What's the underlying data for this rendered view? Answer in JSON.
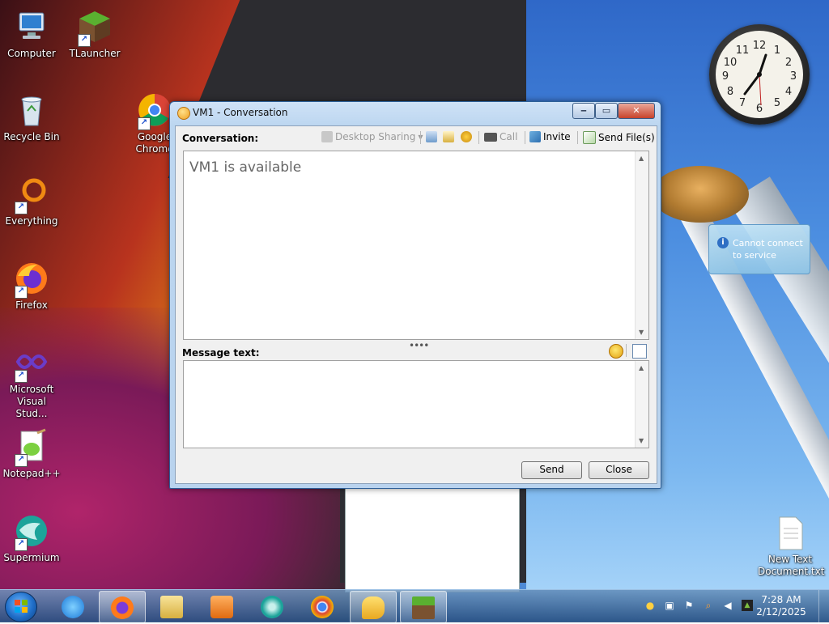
{
  "desktop": {
    "icons": [
      {
        "label": "Computer"
      },
      {
        "label": "TLauncher"
      },
      {
        "label": "Recycle Bin"
      },
      {
        "label": "Google Chrome"
      },
      {
        "label": "Everything"
      },
      {
        "label": "Firefox"
      },
      {
        "label": "Microsoft Visual Stud..."
      },
      {
        "label": "Notepad++"
      },
      {
        "label": "Supermium"
      },
      {
        "label": "New Text Document.txt"
      }
    ]
  },
  "clock_gadget": {
    "numbers": [
      "12",
      "1",
      "2",
      "3",
      "4",
      "5",
      "6",
      "7",
      "8",
      "9",
      "10",
      "11"
    ]
  },
  "balloon": {
    "text": "Cannot connect to service",
    "icon": "info-icon"
  },
  "window": {
    "title": "VM1 - Conversation",
    "toolbar": {
      "conversation_label": "Conversation:",
      "desktop_sharing": "Desktop Sharing",
      "call": "Call",
      "invite": "Invite",
      "send_files": "Send File(s)"
    },
    "conversation_text": "VM1 is available",
    "message_label": "Message text:",
    "message_value": "",
    "send_button": "Send",
    "close_button": "Close"
  },
  "taskbar": {
    "apps": [
      "internet-explorer",
      "firefox",
      "file-explorer",
      "media-player",
      "supermium",
      "chrome",
      "messenger",
      "tlauncher"
    ],
    "time": "7:28 AM",
    "date": "2/12/2025"
  },
  "colors": {
    "accent": "#2d5f98",
    "taskbar": "#3b6ea5"
  }
}
